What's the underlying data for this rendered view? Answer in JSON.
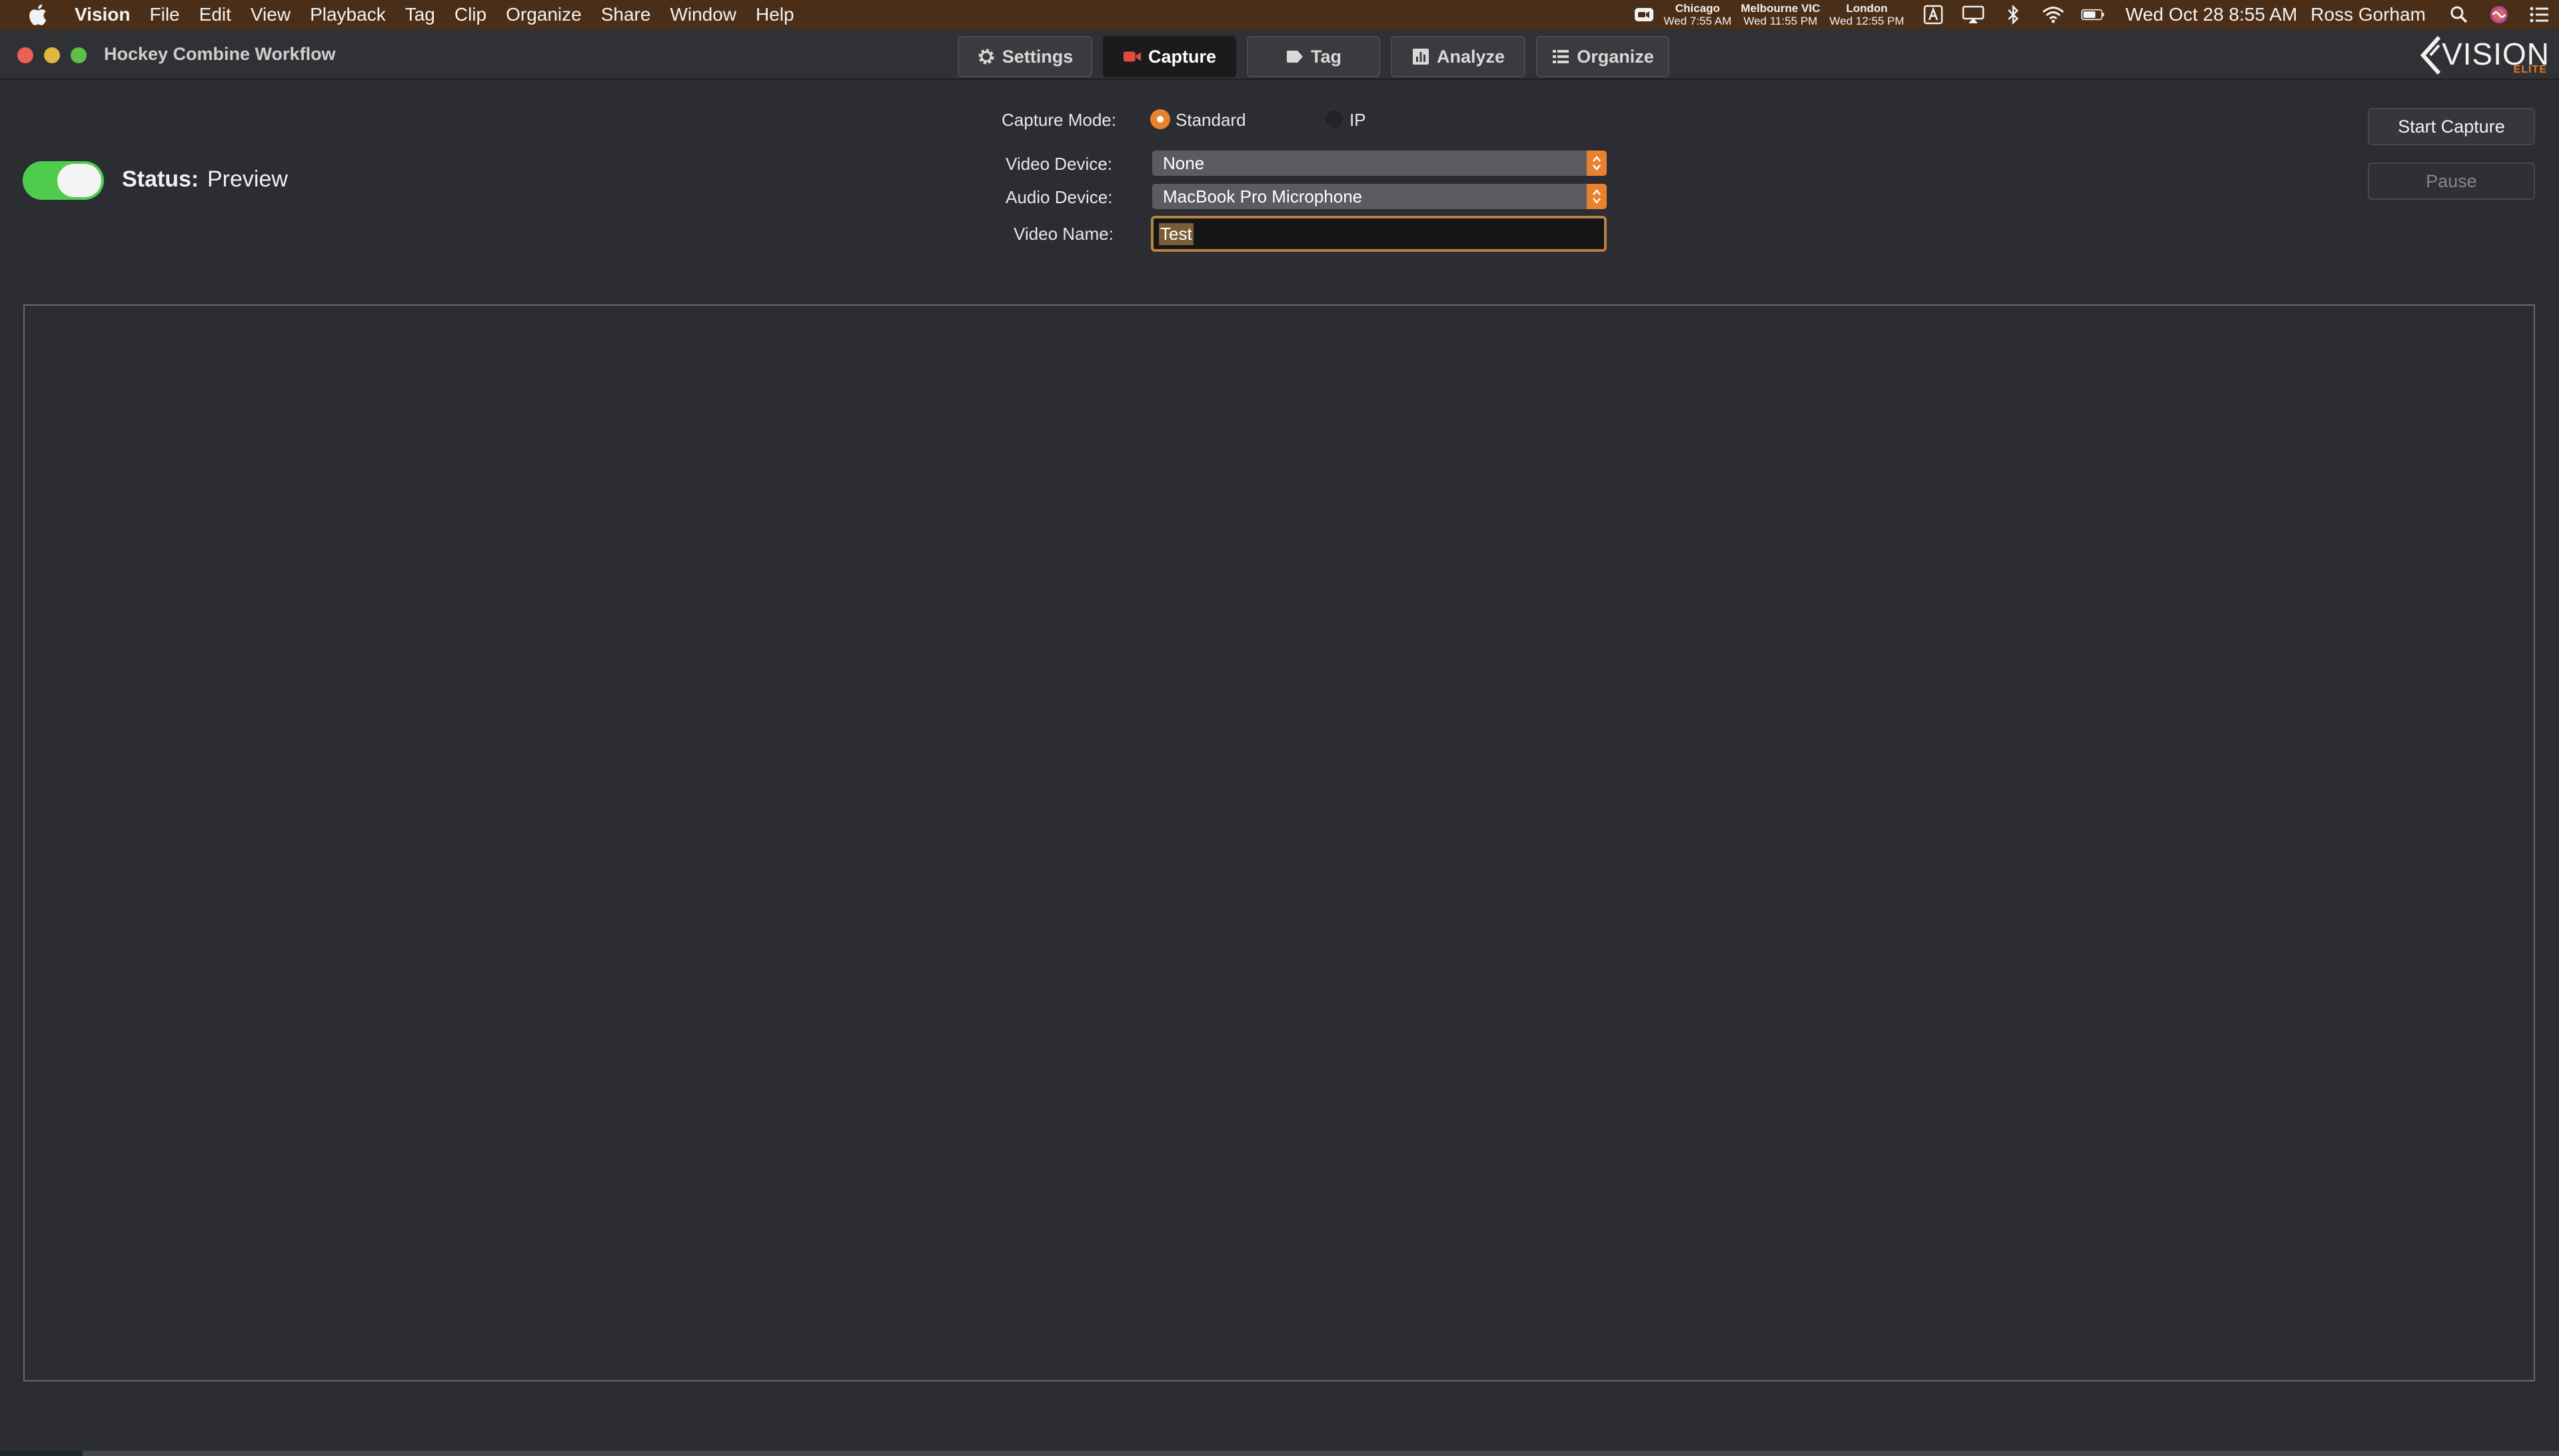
{
  "menubar": {
    "app_name": "Vision",
    "items": [
      "File",
      "Edit",
      "View",
      "Playback",
      "Tag",
      "Clip",
      "Organize",
      "Share",
      "Window",
      "Help"
    ],
    "clocks": [
      {
        "city": "Chicago",
        "time": "Wed 7:55 AM"
      },
      {
        "city": "Melbourne VIC",
        "time": "Wed 11:55 PM"
      },
      {
        "city": "London",
        "time": "Wed 12:55 PM"
      }
    ],
    "date_time": "Wed Oct 28  8:55 AM",
    "user": "Ross Gorham"
  },
  "window": {
    "title": "Hockey Combine Workflow",
    "tabs": [
      {
        "label": "Settings",
        "icon": "gear-icon",
        "active": false
      },
      {
        "label": "Capture",
        "icon": "video-camera-icon",
        "active": true
      },
      {
        "label": "Tag",
        "icon": "tag-icon",
        "active": false
      },
      {
        "label": "Analyze",
        "icon": "chart-icon",
        "active": false
      },
      {
        "label": "Organize",
        "icon": "list-icon",
        "active": false
      }
    ],
    "logo": {
      "word": "VISION",
      "sub": "ELITE"
    }
  },
  "capture": {
    "status_label": "Status:",
    "status_value": "Preview",
    "preview_toggle_on": true,
    "mode_label": "Capture Mode:",
    "mode_options": [
      "Standard",
      "IP"
    ],
    "mode_selected": "Standard",
    "video_device_label": "Video Device:",
    "video_device_value": "None",
    "audio_device_label": "Audio Device:",
    "audio_device_value": "MacBook Pro Microphone",
    "video_name_label": "Video Name:",
    "video_name_value": "Test",
    "start_button": "Start Capture",
    "pause_button": "Pause"
  },
  "colors": {
    "accent": "#e8822f",
    "toggle_on": "#4fcc4b",
    "menubar": "#4b2e17"
  }
}
